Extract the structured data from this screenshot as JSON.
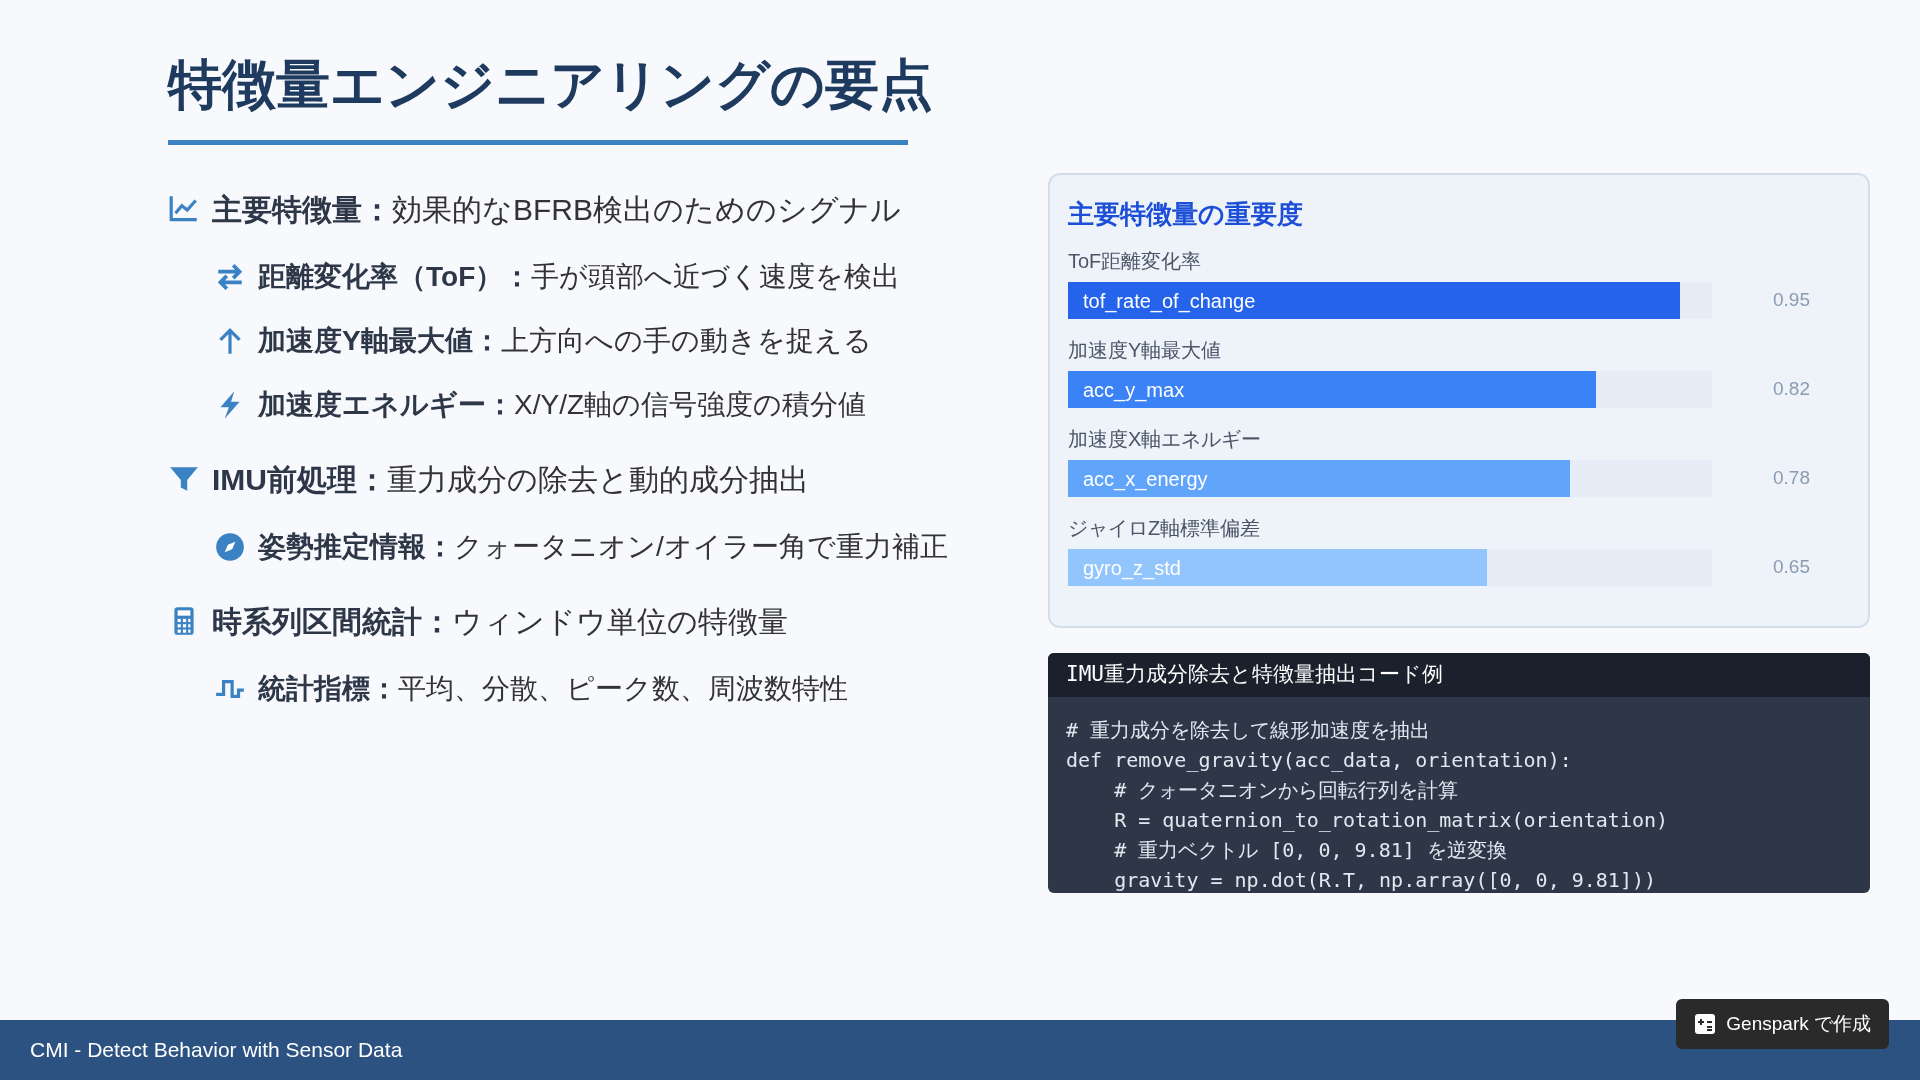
{
  "title": "特徴量エンジニアリングの要点",
  "sections": [
    {
      "heading": "主要特徴量：",
      "text": "効果的なBFRB検出のためのシグナル",
      "children": [
        {
          "heading": "距離変化率（ToF）：",
          "text": "手が頭部へ近づく速度を検出"
        },
        {
          "heading": "加速度Y軸最大値：",
          "text": "上方向への手の動きを捉える"
        },
        {
          "heading": "加速度エネルギー：",
          "text": "X/Y/Z軸の信号強度の積分値"
        }
      ]
    },
    {
      "heading": "IMU前処理：",
      "text": "重力成分の除去と動的成分抽出",
      "children": [
        {
          "heading": "姿勢推定情報：",
          "text": "クォータニオン/オイラー角で重力補正"
        }
      ]
    },
    {
      "heading": "時系列区間統計：",
      "text": "ウィンドウ単位の特徴量",
      "children": [
        {
          "heading": "統計指標：",
          "text": "平均、分散、ピーク数、周波数特性"
        }
      ]
    }
  ],
  "importance": {
    "title": "主要特徴量の重要度",
    "features": [
      {
        "label": "ToF距離変化率",
        "name": "tof_rate_of_change",
        "level": 0.95,
        "reading": "0.95",
        "color": "#2563eb"
      },
      {
        "label": "加速度Y軸最大値",
        "name": "acc_y_max",
        "level": 0.82,
        "reading": "0.82",
        "color": "#3b82f6"
      },
      {
        "label": "加速度X軸エネルギー",
        "name": "acc_x_energy",
        "level": 0.78,
        "reading": "0.78",
        "color": "#60a5fa"
      },
      {
        "label": "ジャイロZ軸標準偏差",
        "name": "gyro_z_std",
        "level": 0.65,
        "reading": "0.65",
        "color": "#93c5fd"
      }
    ]
  },
  "code": {
    "title": "IMU重力成分除去と特徴量抽出コード例",
    "lines": [
      "# 重力成分を除去して線形加速度を抽出",
      "def remove_gravity(acc_data, orientation):",
      "    # クォータニオンから回転行列を計算",
      "    R = quaternion_to_rotation_matrix(orientation)",
      "    # 重力ベクトル [0, 0, 9.81] を逆変換",
      "    gravity = np.dot(R.T, np.array([0, 0, 9.81]))"
    ]
  },
  "footer": {
    "text": "CMI - Detect Behavior with Sensor Data"
  },
  "badge": {
    "label": "Genspark で作成"
  }
}
